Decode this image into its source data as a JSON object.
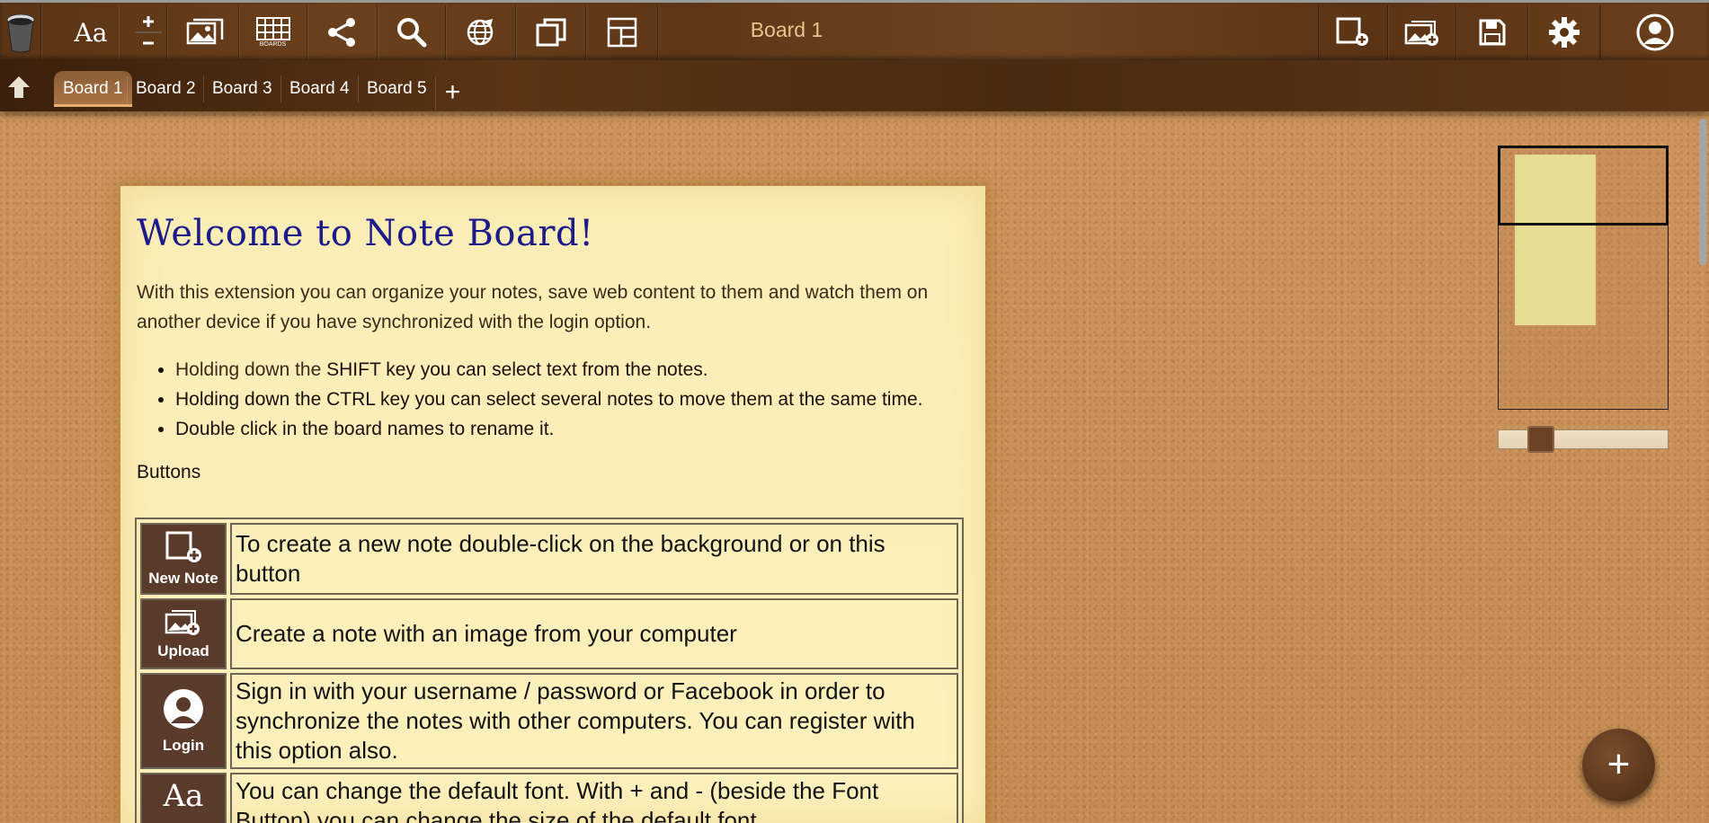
{
  "toolbar": {
    "board_title": "Board 1",
    "font_button_label": "Aa",
    "boards_button_caption": "BOARDS",
    "left_buttons": [
      "trash-icon",
      "font-icon",
      "font-size-icon",
      "images-icon",
      "boards-icon",
      "share-icon",
      "search-icon",
      "globe-icon",
      "windows-icon",
      "layout-icon"
    ],
    "right_buttons": [
      "new-note-icon",
      "upload-image-icon",
      "save-icon",
      "settings-icon",
      "user-icon"
    ]
  },
  "tabs": {
    "items": [
      "Board 1",
      "Board 2",
      "Board 3",
      "Board 4",
      "Board 5"
    ],
    "active": "Board 1",
    "add_label": "+"
  },
  "note": {
    "title": "Welcome to Note Board!",
    "intro": "With this extension you can organize your notes, save web content to them and watch them on another device if you have synchronized with the login option.",
    "bullets": [
      {
        "pre": "Holding down the ",
        "bold": "SHIFT key you can select text from the notes."
      },
      {
        "pre": "",
        "bold": "Holding down the CTRL key you can select several notes to move them at the same time."
      },
      {
        "pre": "",
        "bold": "Double click in the board names to rename it."
      }
    ],
    "buttons_label": "Buttons",
    "rows": [
      {
        "icon": "new-note-icon",
        "caption": "New Note",
        "text": "To create a new note double-click on the background or on this button"
      },
      {
        "icon": "upload-image-icon",
        "caption": "Upload",
        "text": "Create a note with an image from your computer"
      },
      {
        "icon": "user-icon",
        "caption": "Login",
        "text": "Sign in with your username / password or Facebook in order to synchronize the notes with other computers. You can register with this option also."
      },
      {
        "icon": "font-icon",
        "caption": "Aa",
        "text": "You can change the default font. With + and -  (beside the Font Button) you can change the size of the default font."
      }
    ]
  },
  "minimap": {
    "zoom_level": 0.3
  },
  "fab": {
    "label": "+"
  },
  "colors": {
    "wood_dark": "#5a3415",
    "cork": "#c9915a",
    "note_bg": "#fbedb6",
    "title_blue": "#1d1a8a",
    "icon_bg": "#5a3a2a"
  }
}
